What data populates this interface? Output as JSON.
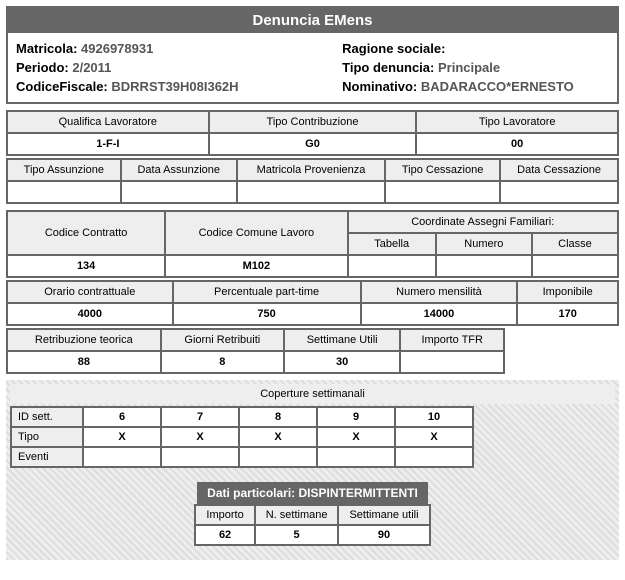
{
  "title": "Denuncia EMens",
  "header": {
    "matricola_lbl": "Matricola:",
    "matricola": "4926978931",
    "periodo_lbl": "Periodo:",
    "periodo": "2/2011",
    "cf_lbl": "CodiceFiscale:",
    "cf": "BDRRST39H08I362H",
    "ragione_lbl": "Ragione sociale:",
    "ragione": "",
    "tipo_denuncia_lbl": "Tipo denuncia:",
    "tipo_denuncia": "Principale",
    "nominativo_lbl": "Nominativo:",
    "nominativo": "BADARACCO*ERNESTO"
  },
  "sec1": {
    "h0": "Qualifica Lavoratore",
    "h1": "Tipo Contribuzione",
    "h2": "Tipo Lavoratore",
    "v0": "1-F-I",
    "v1": "G0",
    "v2": "00"
  },
  "sec2": {
    "h0": "Tipo Assunzione",
    "h1": "Data Assunzione",
    "h2": "Matricola Provenienza",
    "h3": "Tipo Cessazione",
    "h4": "Data Cessazione",
    "v0": " ",
    "v1": " ",
    "v2": " ",
    "v3": " ",
    "v4": " "
  },
  "sec3": {
    "h0": "Codice Contratto",
    "h1": "Codice Comune Lavoro",
    "h2": "Coordinate Assegni Familiari:",
    "h3": "Tabella",
    "h4": "Numero",
    "h5": "Classe",
    "v0": "134",
    "v1": "M102",
    "v2": " ",
    "v3": " ",
    "v4": " "
  },
  "sec4": {
    "h0": "Orario contrattuale",
    "h1": "Percentuale part-time",
    "h2": "Numero mensilità",
    "h3": "Imponibile",
    "v0": "4000",
    "v1": "750",
    "v2": "14000",
    "v3": "170"
  },
  "sec5": {
    "h0": "Retribuzione teorica",
    "h1": "Giorni Retribuiti",
    "h2": "Settimane Utili",
    "h3": "Importo TFR",
    "v0": "88",
    "v1": "8",
    "v2": "30",
    "v3": " "
  },
  "coperture": {
    "title": "Coperture settimanali",
    "rows": [
      "ID sett.",
      "Tipo",
      "Eventi"
    ],
    "idsett": [
      "6",
      "7",
      "8",
      "9",
      "10"
    ],
    "tipo": [
      "X",
      "X",
      "X",
      "X",
      "X"
    ]
  },
  "dati_particolari": {
    "title": "Dati particolari: DISPINTERMITTENTI",
    "h0": "Importo",
    "h1": "N. settimane",
    "h2": "Settimane utili",
    "v0": "62",
    "v1": "5",
    "v2": "90"
  }
}
